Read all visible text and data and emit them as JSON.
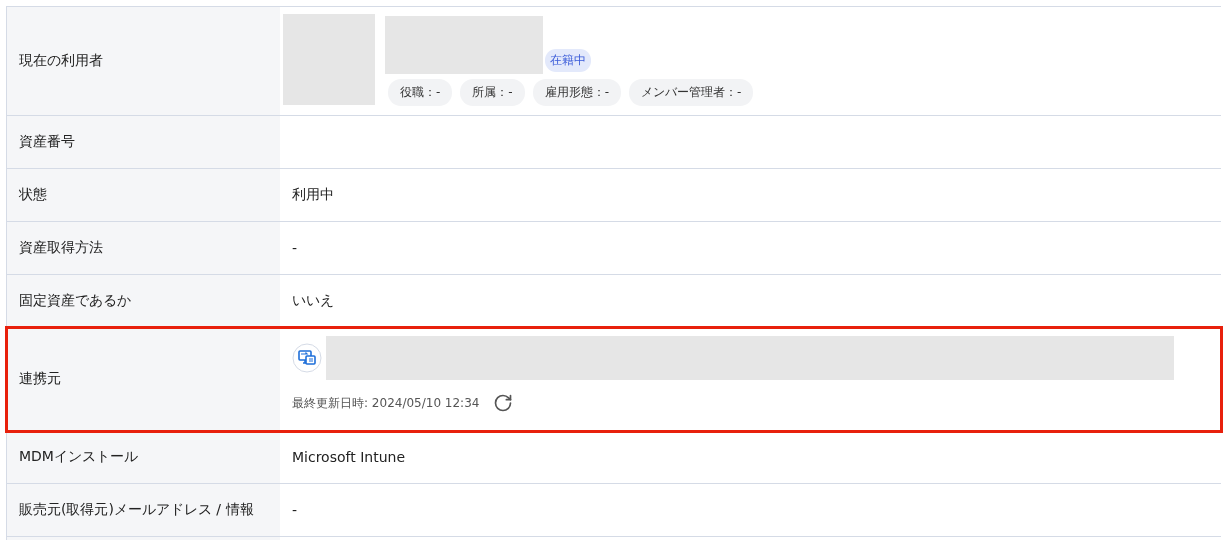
{
  "rows": [
    {
      "kind": "user",
      "label": "現在の利用者",
      "status_badge": "在籍中",
      "chips": [
        "役職：-",
        "所属：-",
        "雇用形態：-",
        "メンバー管理者：-"
      ],
      "highlighted": false
    },
    {
      "kind": "text",
      "label": "資産番号",
      "highlighted": false
    },
    {
      "kind": "text",
      "label": "状態",
      "value": "利用中",
      "highlighted": false
    },
    {
      "kind": "text",
      "label": "資産取得方法",
      "value": "-",
      "highlighted": false
    },
    {
      "kind": "text",
      "label": "固定資産であるか",
      "value": "いいえ",
      "highlighted": false
    },
    {
      "kind": "integration",
      "label": "連携元",
      "updated": "最終更新日時: 2024/05/10 12:34",
      "highlighted": true
    },
    {
      "kind": "text",
      "label": "MDMインストール",
      "value": "Microsoft Intune",
      "highlighted": false
    },
    {
      "kind": "text",
      "label": "販売元(取得元)メールアドレス / 情報",
      "value": "-",
      "highlighted": false
    },
    {
      "kind": "text",
      "label": "",
      "highlighted": false
    }
  ]
}
